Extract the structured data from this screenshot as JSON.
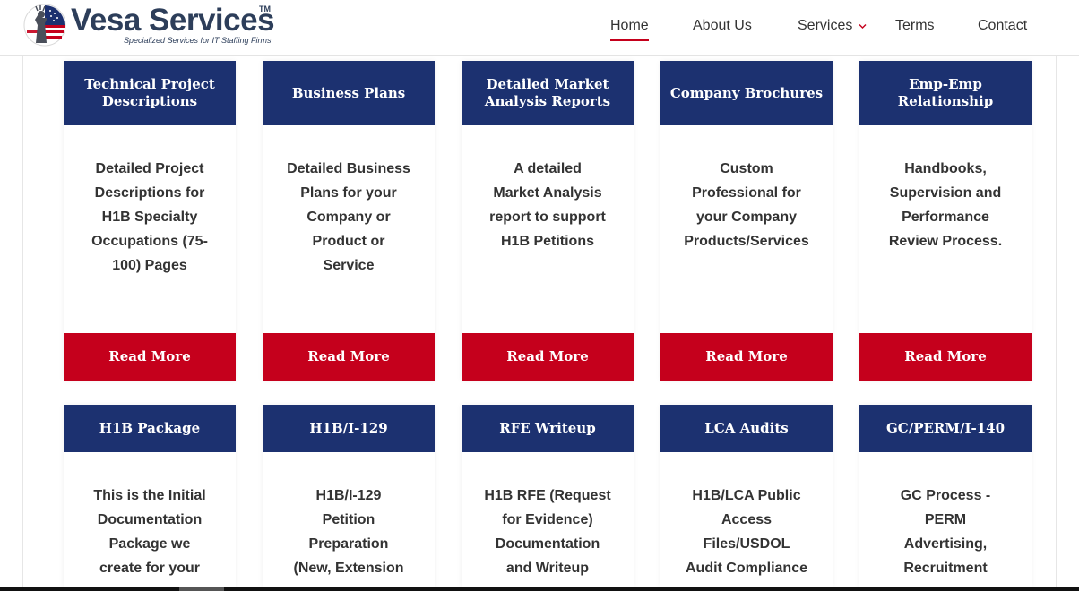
{
  "brand": {
    "name": "Vesa Services",
    "trademark": "TM",
    "tagline": "Specialized Services for IT Staffing Firms"
  },
  "nav": {
    "items": [
      {
        "label": "Home",
        "active": true
      },
      {
        "label": "About Us"
      },
      {
        "label": "Services",
        "has_dropdown": true
      },
      {
        "label": "Terms"
      },
      {
        "label": "Contact"
      }
    ]
  },
  "colors": {
    "card_header": "#1c3170",
    "button": "#c5001c",
    "accent": "#c5001c"
  },
  "cards_row1": [
    {
      "title": "Technical Project Descriptions",
      "lines": [
        "Detailed Project",
        "Descriptions for",
        "H1B Specialty",
        "Occupations (75-",
        "100) Pages"
      ],
      "button": "Read More"
    },
    {
      "title": "Business Plans",
      "lines": [
        "Detailed Business",
        "Plans for your",
        "Company or",
        "Product or",
        "Service"
      ],
      "button": "Read More"
    },
    {
      "title": "Detailed Market Analysis Reports",
      "lines": [
        "A detailed",
        "Market Analysis",
        "report to support",
        "H1B Petitions"
      ],
      "button": "Read More"
    },
    {
      "title": "Company Brochures",
      "lines": [
        "Custom",
        "Professional for",
        "your Company",
        "Products/Services"
      ],
      "button": "Read More"
    },
    {
      "title": "Emp-Emp Relationship",
      "lines": [
        "Handbooks,",
        "Supervision and",
        "Performance",
        "Review Process."
      ],
      "button": "Read More"
    }
  ],
  "cards_row2": [
    {
      "title": "H1B Package",
      "lines": [
        "This is the Initial",
        "Documentation",
        "Package we",
        "create for your"
      ]
    },
    {
      "title": "H1B/I-129",
      "lines": [
        "H1B/I-129",
        "Petition",
        "Preparation",
        "(New, Extension"
      ]
    },
    {
      "title": "RFE Writeup",
      "lines": [
        "H1B RFE (Request",
        "for Evidence)",
        "Documentation",
        "and Writeup"
      ]
    },
    {
      "title": "LCA Audits",
      "lines": [
        "H1B/LCA Public",
        "Access",
        "Files/USDOL",
        "Audit Compliance"
      ]
    },
    {
      "title": "GC/PERM/I-140",
      "lines": [
        "GC Process -",
        "PERM",
        "Advertising,",
        "Recruitment"
      ]
    }
  ]
}
